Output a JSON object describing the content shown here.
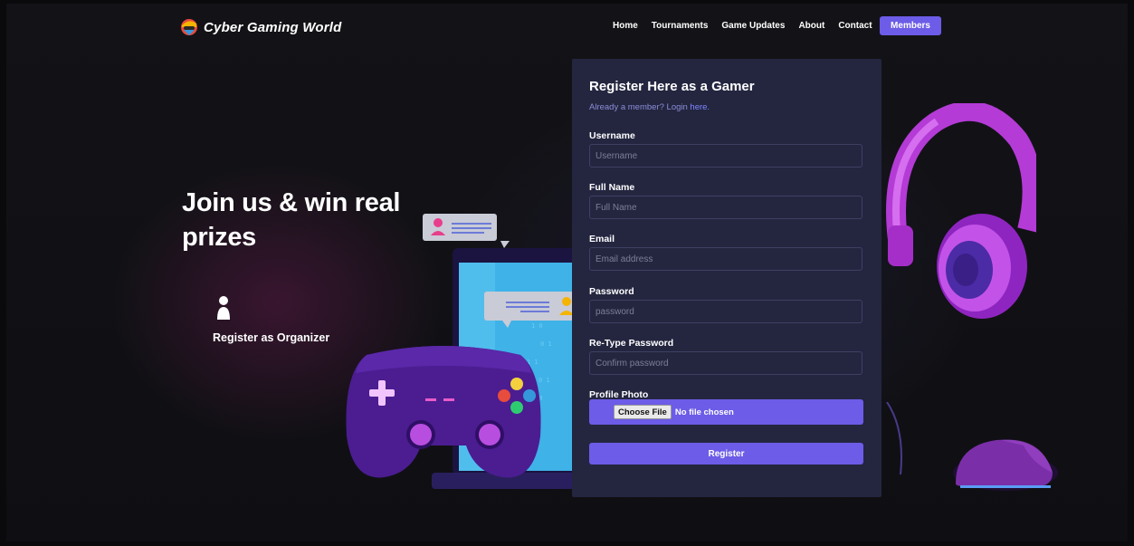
{
  "brand": {
    "name": "Cyber Gaming World"
  },
  "nav": {
    "items": [
      "Home",
      "Tournaments",
      "Game Updates",
      "About",
      "Contact"
    ],
    "members_label": "Members"
  },
  "hero": {
    "title": "Join us & win real prizes",
    "organizer_label": "Register as Organizer"
  },
  "form": {
    "title": "Register Here as a Gamer",
    "already_text": "Already a member? Login ",
    "login_link": "here.",
    "fields": [
      {
        "label": "Username",
        "placeholder": "Username"
      },
      {
        "label": "Full Name",
        "placeholder": "Full Name"
      },
      {
        "label": "Email",
        "placeholder": "Email address"
      },
      {
        "label": "Password",
        "placeholder": "password"
      },
      {
        "label": "Re-Type Password",
        "placeholder": "Confirm password"
      }
    ],
    "photo_label": "Profile Photo",
    "choose_file_label": "Choose File",
    "file_status": "No file chosen",
    "submit_label": "Register"
  },
  "colors": {
    "accent": "#6c5ce7",
    "panel": "#242640",
    "background": "#131317"
  }
}
